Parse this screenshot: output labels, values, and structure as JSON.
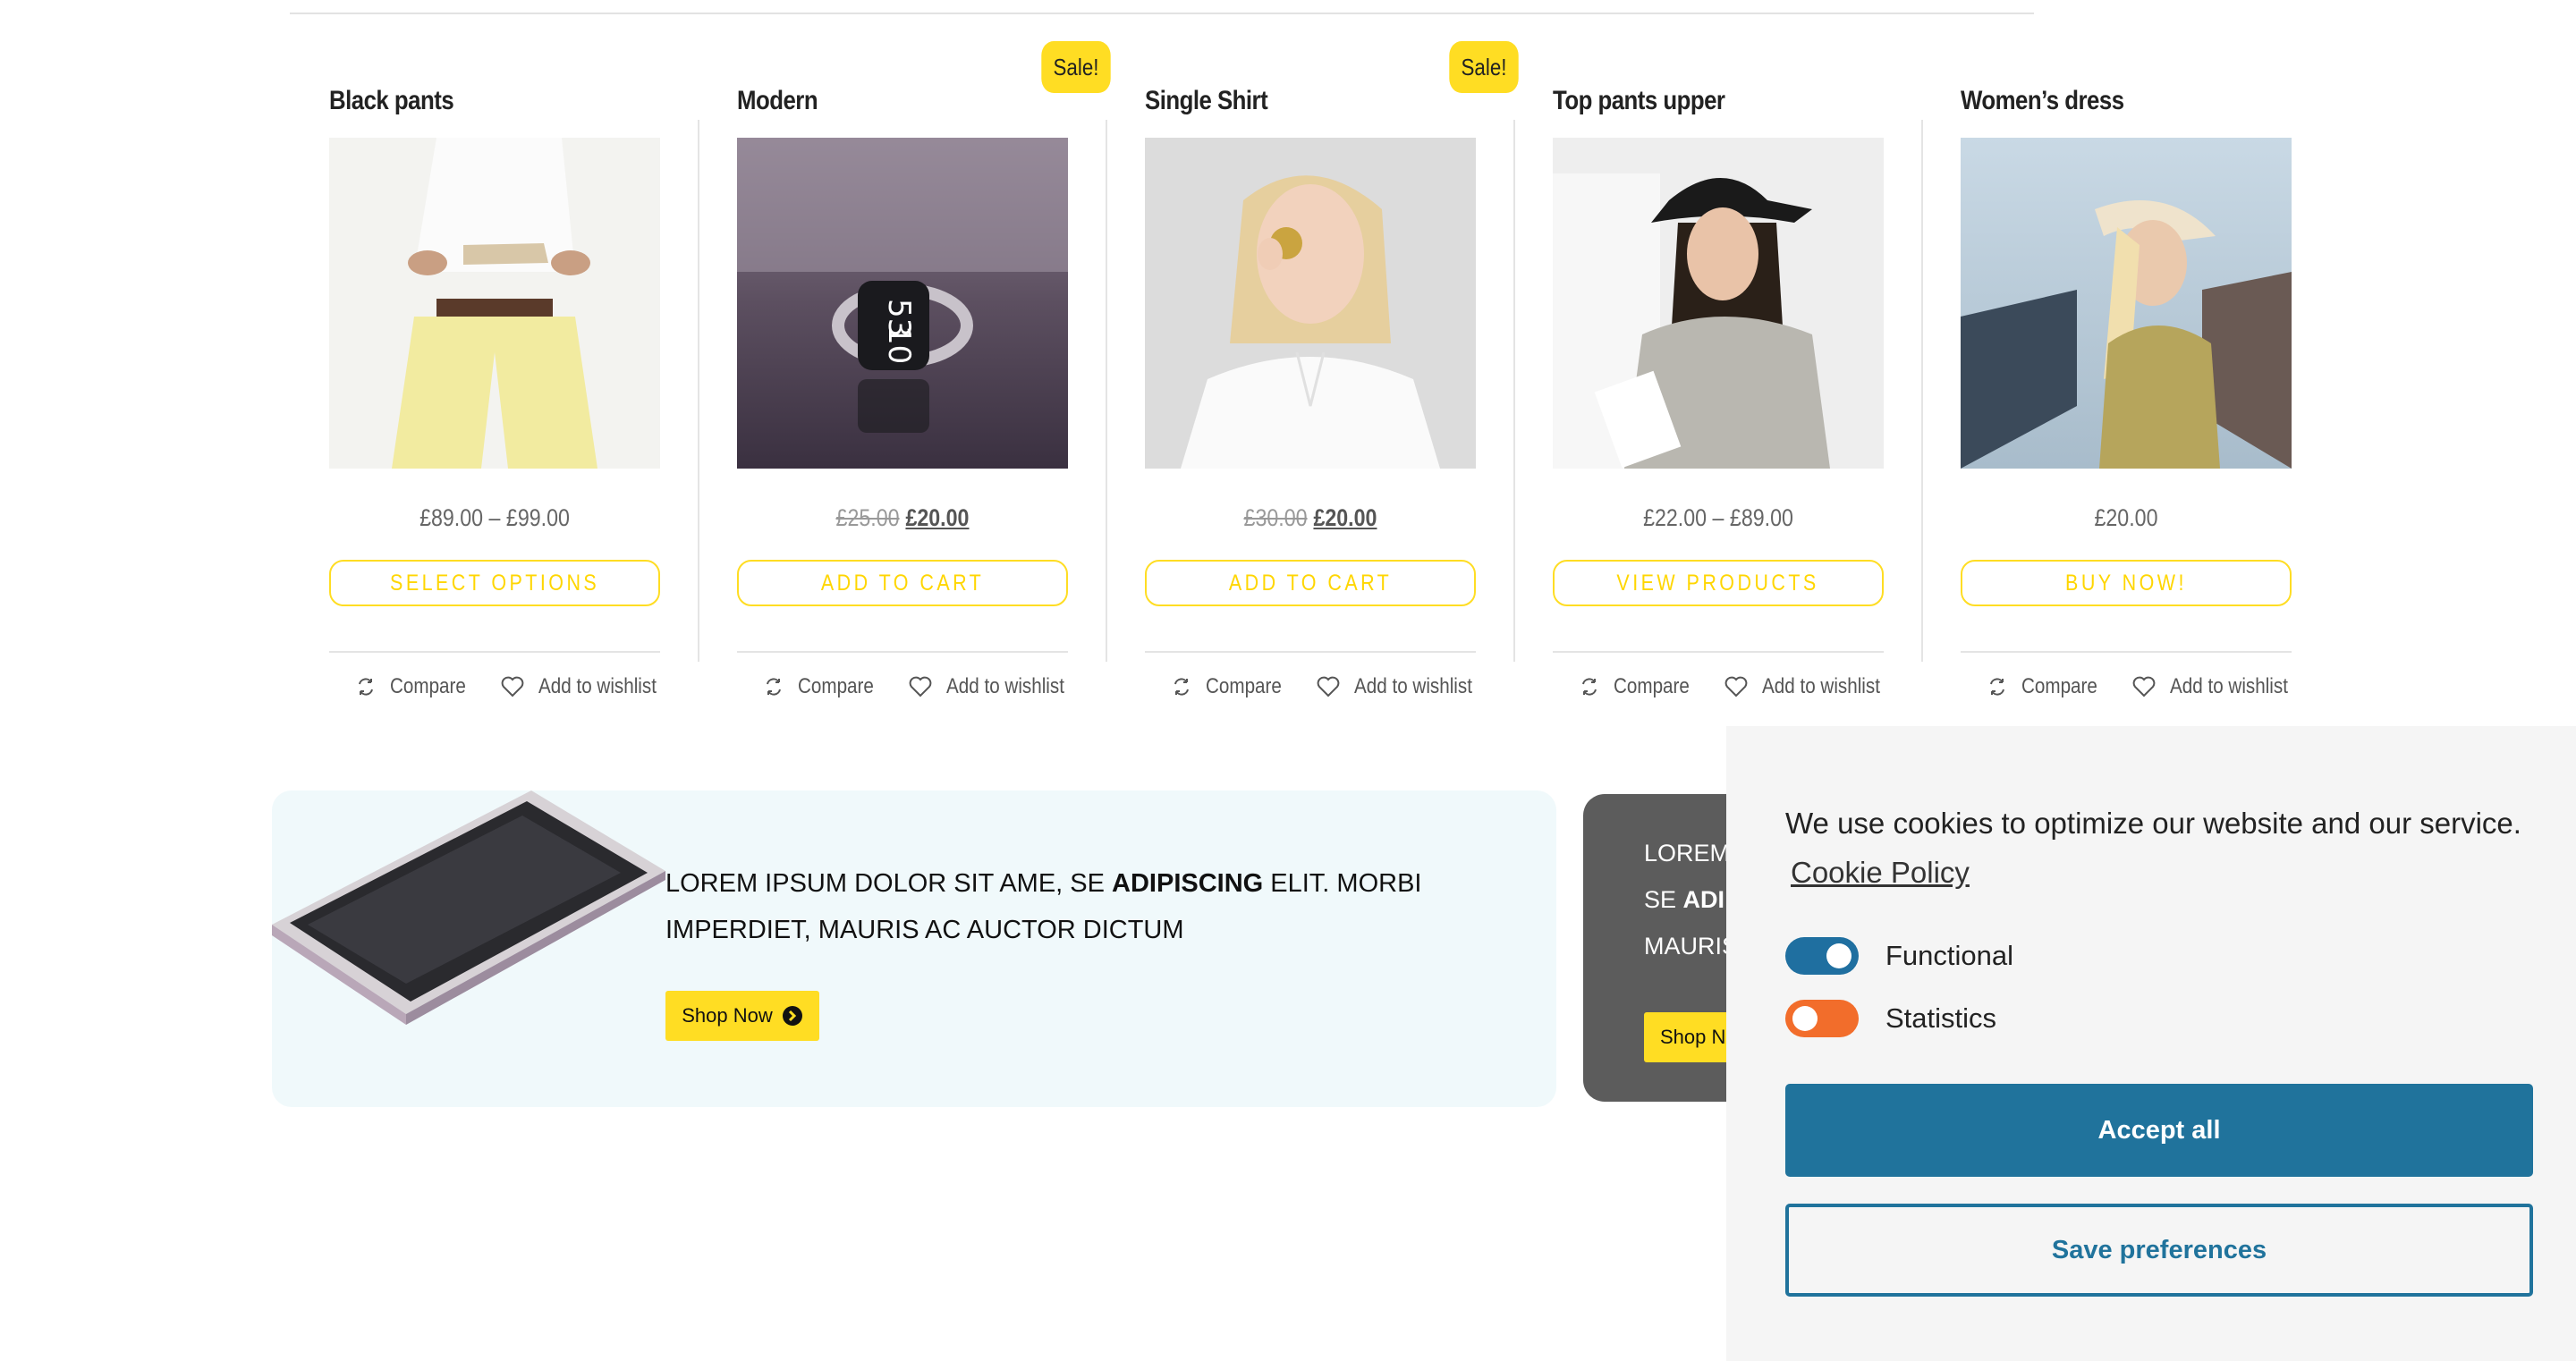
{
  "colors": {
    "accent_yellow": "#ffdd23",
    "cookie_primary": "#20739c",
    "toggle_functional": "#1f6fa0",
    "toggle_statistics": "#f26d2b",
    "banner_light_bg": "#f0f9fb",
    "banner_dark_bg": "#5c5c5c"
  },
  "products": [
    {
      "title": "Black pants",
      "sale": false,
      "price": "£89.00 – £99.00",
      "old_price": "",
      "new_price": "",
      "cta": "SELECT OPTIONS",
      "compare": "Compare",
      "wishlist": "Add to wishlist"
    },
    {
      "title": "Modern",
      "sale": true,
      "sale_label": "Sale!",
      "price": "",
      "old_price": "£25.00",
      "new_price": "£20.00",
      "cta": "ADD TO CART",
      "compare": "Compare",
      "wishlist": "Add to wishlist"
    },
    {
      "title": "Single Shirt",
      "sale": true,
      "sale_label": "Sale!",
      "price": "",
      "old_price": "£30.00",
      "new_price": "£20.00",
      "cta": "ADD TO CART",
      "compare": "Compare",
      "wishlist": "Add to wishlist"
    },
    {
      "title": "Top pants upper",
      "sale": false,
      "price": "£22.00 – £89.00",
      "old_price": "",
      "new_price": "",
      "cta": "VIEW PRODUCTS",
      "compare": "Compare",
      "wishlist": "Add to wishlist"
    },
    {
      "title": "Women’s dress",
      "sale": false,
      "price": "£20.00",
      "old_price": "",
      "new_price": "",
      "cta": "BUY NOW!",
      "compare": "Compare",
      "wishlist": "Add to wishlist"
    }
  ],
  "banners": {
    "left": {
      "text_pre": "LOREM IPSUM DOLOR SIT AME, SE ",
      "text_bold": "ADIPISCING",
      "text_post": " ELIT. MORBI IMPERDIET, MAURIS AC AUCTOR DICTUM",
      "button": "Shop Now"
    },
    "right": {
      "line1": "LOREM",
      "line2_pre": "SE ",
      "line2_bold": "ADI",
      "line3": "MAURIS",
      "button": "Shop N"
    }
  },
  "cookie": {
    "message": "We use cookies to optimize our website and our service.",
    "policy_link": "Cookie Policy",
    "toggles": [
      {
        "label": "Functional",
        "on": true
      },
      {
        "label": "Statistics",
        "on": false
      }
    ],
    "accept_label": "Accept all",
    "save_label": "Save preferences"
  }
}
